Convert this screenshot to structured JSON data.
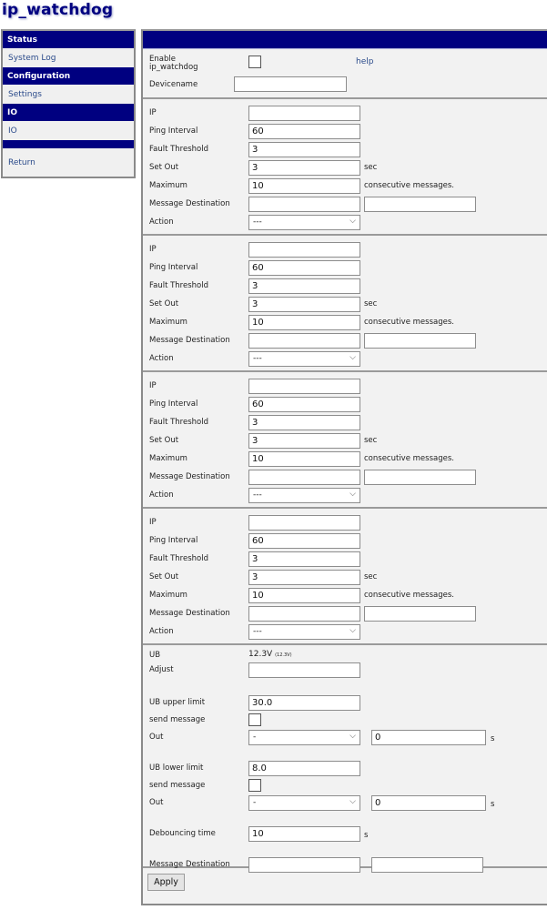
{
  "app": {
    "title": "ip_watchdog"
  },
  "sidebar": {
    "sections": [
      {
        "header": "Status",
        "items": [
          "System Log"
        ]
      },
      {
        "header": "Configuration",
        "items": [
          "Settings"
        ]
      },
      {
        "header": "IO",
        "items": [
          "IO"
        ]
      },
      {
        "header": "",
        "items": [
          "Return"
        ]
      }
    ]
  },
  "general": {
    "enable_label": "Enable ip_watchdog",
    "enable_checked": false,
    "help_link": "help",
    "devicename_label": "Devicename",
    "devicename_value": ""
  },
  "ip_labels": {
    "ip": "IP",
    "ping_interval": "Ping Interval",
    "fault_threshold": "Fault Threshold",
    "set_out": "Set Out",
    "set_out_unit": "sec",
    "maximum": "Maximum",
    "maximum_unit": "consecutive messages.",
    "message_destination": "Message Destination",
    "action": "Action"
  },
  "ip_blocks": [
    {
      "ip": "",
      "ping_interval": "60",
      "fault_threshold": "3",
      "set_out": "3",
      "maximum": "10",
      "dest1": "",
      "dest2": "",
      "action": "---"
    },
    {
      "ip": "",
      "ping_interval": "60",
      "fault_threshold": "3",
      "set_out": "3",
      "maximum": "10",
      "dest1": "",
      "dest2": "",
      "action": "---"
    },
    {
      "ip": "",
      "ping_interval": "60",
      "fault_threshold": "3",
      "set_out": "3",
      "maximum": "10",
      "dest1": "",
      "dest2": "",
      "action": "---"
    },
    {
      "ip": "",
      "ping_interval": "60",
      "fault_threshold": "3",
      "set_out": "3",
      "maximum": "10",
      "dest1": "",
      "dest2": "",
      "action": "---"
    }
  ],
  "ub": {
    "ub_label": "UB",
    "ub_value": "12.3V",
    "ub_raw": "(12.3V)",
    "adjust_label": "Adjust",
    "adjust_value": "",
    "upper_label": "UB upper limit",
    "upper_value": "30.0",
    "upper_send_label": "send message",
    "upper_send_checked": false,
    "upper_out_label": "Out",
    "upper_out_select": "-",
    "upper_out_value": "0",
    "upper_out_unit": "s",
    "lower_label": "UB lower limit",
    "lower_value": "8.0",
    "lower_send_label": "send message",
    "lower_send_checked": false,
    "lower_out_label": "Out",
    "lower_out_select": "-",
    "lower_out_value": "0",
    "lower_out_unit": "s",
    "debounce_label": "Debouncing time",
    "debounce_value": "10",
    "debounce_unit": "s",
    "dest_label": "Message Destination",
    "dest1": "",
    "dest2": ""
  },
  "footer": {
    "apply_label": "Apply"
  },
  "icons": {
    "chevron": "⌵"
  },
  "colors": {
    "header_navy": "#000080",
    "link_blue": "#2a4a8a",
    "panel_bg": "#f2f2f2"
  }
}
